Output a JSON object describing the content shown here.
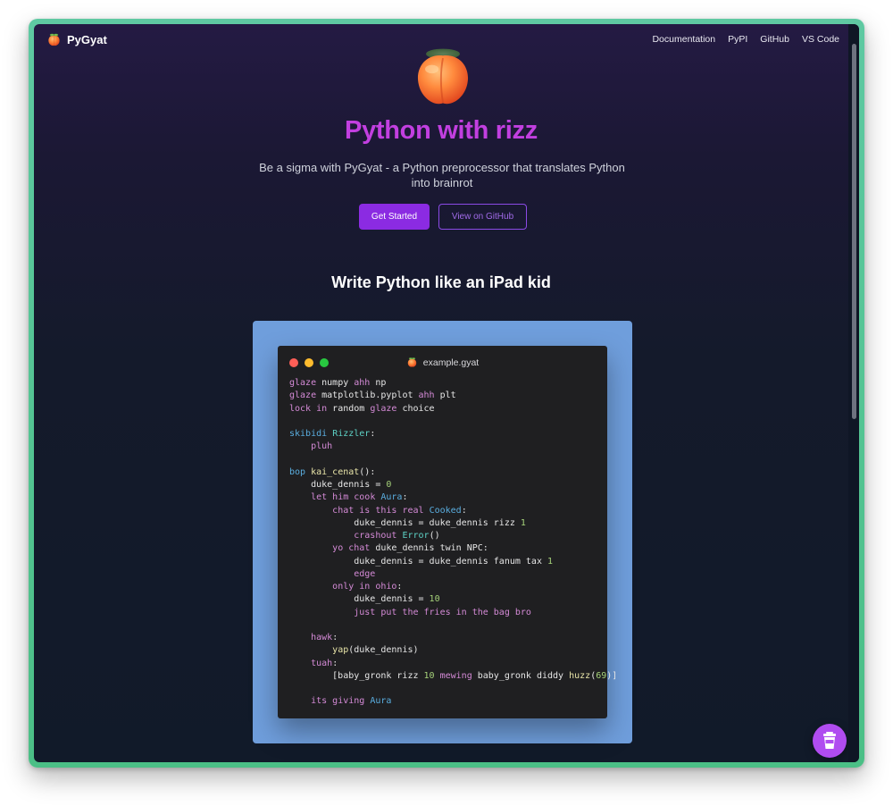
{
  "nav": {
    "brand": "PyGyat",
    "links": [
      "Documentation",
      "PyPI",
      "GitHub",
      "VS Code"
    ]
  },
  "hero": {
    "title": "Python with rizz",
    "subtitle": "Be a sigma with PyGyat - a Python preprocessor that translates Python into brainrot",
    "primary_button": "Get Started",
    "secondary_button": "View on GitHub"
  },
  "section": {
    "title": "Write Python like an iPad kid"
  },
  "code_window": {
    "filename": "example.gyat",
    "lines": [
      [
        [
          "glaze",
          "kw"
        ],
        [
          " numpy ",
          ""
        ],
        [
          "ahh",
          "kw"
        ],
        [
          " np",
          ""
        ]
      ],
      [
        [
          "glaze",
          "kw"
        ],
        [
          " matplotlib.pyplot ",
          ""
        ],
        [
          "ahh",
          "kw"
        ],
        [
          " plt",
          ""
        ]
      ],
      [
        [
          "lock in",
          "kw"
        ],
        [
          " random ",
          ""
        ],
        [
          "glaze",
          "kw"
        ],
        [
          " choice",
          ""
        ]
      ],
      [],
      [
        [
          "skibidi",
          "bi"
        ],
        [
          " ",
          ""
        ],
        [
          "Rizzler",
          "cls"
        ],
        [
          ":",
          ""
        ]
      ],
      [
        [
          "    ",
          ""
        ],
        [
          "pluh",
          "kw"
        ]
      ],
      [],
      [
        [
          "bop",
          "bi"
        ],
        [
          " ",
          ""
        ],
        [
          "kai_cenat",
          "fn"
        ],
        [
          "():",
          ""
        ]
      ],
      [
        [
          "    duke_dennis = ",
          ""
        ],
        [
          "0",
          "num"
        ]
      ],
      [
        [
          "    ",
          ""
        ],
        [
          "let him cook",
          "kw"
        ],
        [
          " ",
          ""
        ],
        [
          "Aura",
          "bi"
        ],
        [
          ":",
          ""
        ]
      ],
      [
        [
          "        ",
          ""
        ],
        [
          "chat is this real",
          "kw"
        ],
        [
          " ",
          ""
        ],
        [
          "Cooked",
          "bi"
        ],
        [
          ":",
          ""
        ]
      ],
      [
        [
          "            duke_dennis = duke_dennis rizz ",
          ""
        ],
        [
          "1",
          "num"
        ]
      ],
      [
        [
          "            ",
          ""
        ],
        [
          "crashout",
          "kw"
        ],
        [
          " ",
          ""
        ],
        [
          "Error",
          "cls"
        ],
        [
          "()",
          ""
        ]
      ],
      [
        [
          "        ",
          ""
        ],
        [
          "yo chat",
          "kw"
        ],
        [
          " duke_dennis twin NPC:",
          ""
        ]
      ],
      [
        [
          "            duke_dennis = duke_dennis fanum tax ",
          ""
        ],
        [
          "1",
          "num"
        ]
      ],
      [
        [
          "            ",
          ""
        ],
        [
          "edge",
          "kw"
        ]
      ],
      [
        [
          "        ",
          ""
        ],
        [
          "only in ohio",
          "kw"
        ],
        [
          ":",
          ""
        ]
      ],
      [
        [
          "            duke_dennis = ",
          ""
        ],
        [
          "10",
          "num"
        ]
      ],
      [
        [
          "            ",
          ""
        ],
        [
          "just put the fries in the bag bro",
          "kw"
        ]
      ],
      [],
      [
        [
          "    ",
          ""
        ],
        [
          "hawk",
          "kw"
        ],
        [
          ":",
          ""
        ]
      ],
      [
        [
          "        ",
          ""
        ],
        [
          "yap",
          "fn"
        ],
        [
          "(duke_dennis)",
          ""
        ]
      ],
      [
        [
          "    ",
          ""
        ],
        [
          "tuah",
          "kw"
        ],
        [
          ":",
          ""
        ]
      ],
      [
        [
          "        [baby_gronk rizz ",
          ""
        ],
        [
          "10",
          "num"
        ],
        [
          " ",
          ""
        ],
        [
          "mewing",
          "kw"
        ],
        [
          " baby_gronk diddy ",
          ""
        ],
        [
          "huzz",
          "fn"
        ],
        [
          "(",
          ""
        ],
        [
          "69",
          "num"
        ],
        [
          ")]",
          ""
        ]
      ],
      [],
      [
        [
          "    ",
          ""
        ],
        [
          "its giving",
          "kw"
        ],
        [
          " ",
          ""
        ],
        [
          "Aura",
          "bi"
        ]
      ]
    ]
  },
  "colors": {
    "accent": "#8b2be2",
    "title": "#c23fe0",
    "frame": "#4bbf86",
    "code_backdrop": "#6f9edc"
  },
  "icons": {
    "logo": "peach-icon",
    "fab": "coffee-cup-icon"
  }
}
